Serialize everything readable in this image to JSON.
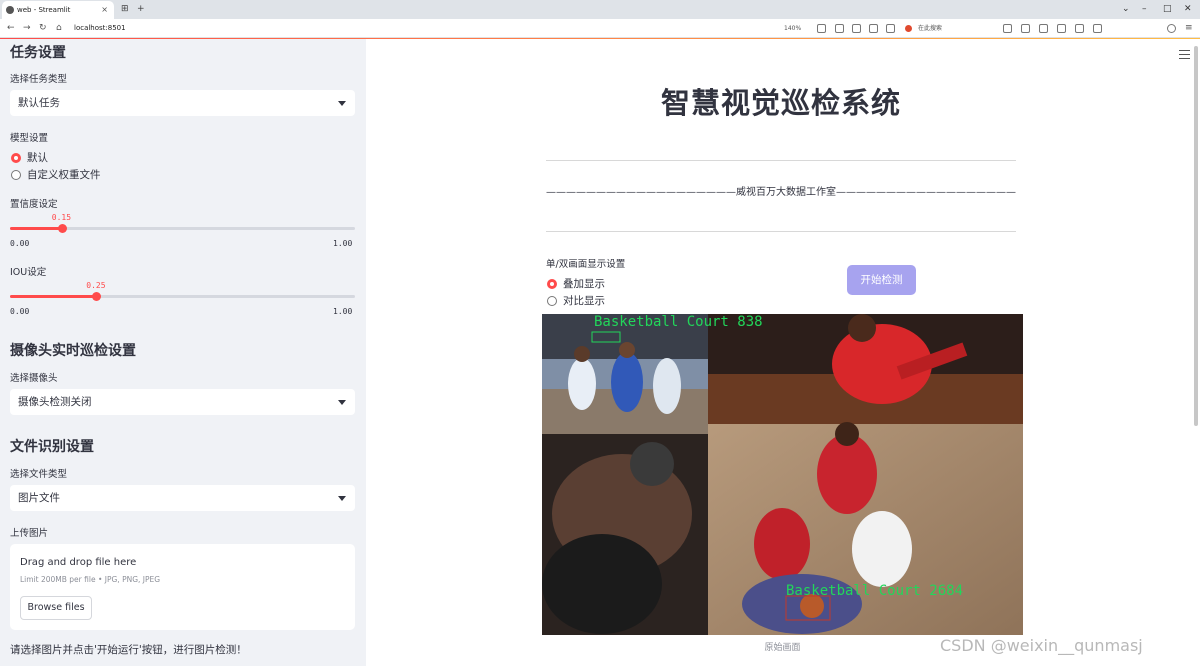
{
  "browser": {
    "tab_title": "web - Streamlit",
    "url": "localhost:8501",
    "zoom": "140%",
    "search_placeholder": "在此搜索"
  },
  "sidebar": {
    "task_heading": "任务设置",
    "task_type_label": "选择任务类型",
    "task_type_value": "默认任务",
    "model_label": "模型设置",
    "model_options": [
      "默认",
      "自定义权重文件"
    ],
    "model_selected": "默认",
    "conf_label": "置信度设定",
    "conf_value": "0.15",
    "conf_fraction": 0.15,
    "iou_label": "IOU设定",
    "iou_value": "0.25",
    "iou_fraction": 0.25,
    "slider_min": "0.00",
    "slider_max": "1.00",
    "camera_heading": "摄像头实时巡检设置",
    "camera_label": "选择摄像头",
    "camera_value": "摄像头检测关闭",
    "file_heading": "文件识别设置",
    "file_type_label": "选择文件类型",
    "file_type_value": "图片文件",
    "upload_label": "上传图片",
    "upload_title": "Drag and drop file here",
    "upload_limit": "Limit 200MB per file • JPG, PNG, JPEG",
    "browse_label": "Browse files",
    "hint": "请选择图片并点击'开始运行'按钮，进行图片检测！"
  },
  "main": {
    "title": "智慧视觉巡检系统",
    "studio_line": "———————————————————威视百万大数据工作室——————————————————————",
    "display_mode_label": "单/双画面显示设置",
    "display_options": [
      "叠加显示",
      "对比显示"
    ],
    "display_selected": "叠加显示",
    "start_button": "开始检测",
    "detection_labels": [
      "Basketball Court 838",
      "Basketball Court 2684"
    ],
    "image_caption": "原始画面",
    "watermark": "CSDN @weixin__qunmasj"
  },
  "colors": {
    "accent": "#ff4b4b",
    "button": "#a7a3ef",
    "sidebar_bg": "#f0f2f6",
    "detection_box": "#22d65a"
  }
}
